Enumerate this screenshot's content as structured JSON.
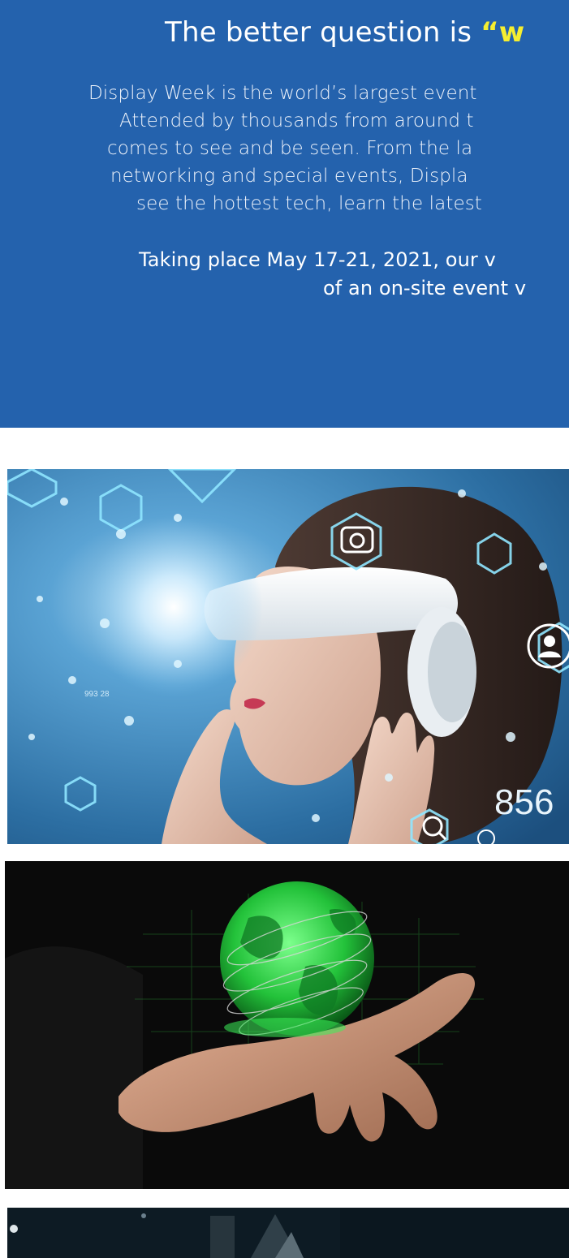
{
  "hero": {
    "headline_prefix": "The better question is ",
    "headline_accent": "“w",
    "paragraph1": [
      "Display Week is the world’s largest event",
      "Attended by thousands from around t",
      "comes to see and be seen. From the la",
      "networking and special events, Displa",
      "see the hottest tech, learn the latest"
    ],
    "paragraph2": [
      "Taking place May 17-21, 2021, our v",
      "of an on-site event v"
    ],
    "colors": {
      "background": "#2462ad",
      "accent": "#f5ee30",
      "text": "#ffffff"
    }
  },
  "images": {
    "vr": {
      "overlay_number": "856",
      "small_number": "993 28"
    },
    "globe": {},
    "dark": {}
  }
}
